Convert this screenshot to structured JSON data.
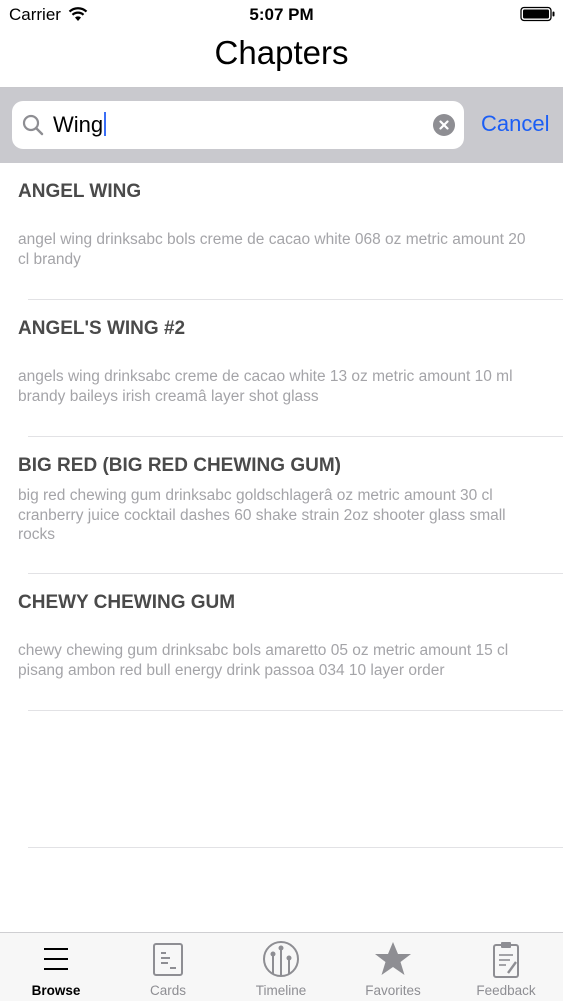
{
  "status_bar": {
    "carrier": "Carrier",
    "time": "5:07 PM"
  },
  "nav": {
    "title": "Chapters"
  },
  "search": {
    "query": "Wing",
    "cancel_label": "Cancel"
  },
  "results": [
    {
      "title": "ANGEL WING",
      "description": "angel wing drinksabc bols creme de cacao white 068 oz metric amount 20 cl brandy"
    },
    {
      "title": "ANGEL'S WING #2",
      "description": "angels wing drinksabc creme de cacao white 13 oz metric amount 10 ml brandy baileys irish creamâ layer shot glass"
    },
    {
      "title": "BIG RED  (BIG RED CHEWING GUM)",
      "description": "big red chewing gum drinksabc goldschlagerâ oz metric amount 30 cl cranberry juice cocktail dashes 60 shake strain 2oz shooter glass small rocks"
    },
    {
      "title": "CHEWY CHEWING GUM",
      "description": "chewy chewing gum drinksabc bols amaretto 05 oz metric amount 15 cl pisang ambon red bull energy drink passoa 034 10 layer order"
    }
  ],
  "tab_bar": {
    "tabs": [
      {
        "label": "Browse",
        "icon": "list-icon",
        "active": true
      },
      {
        "label": "Cards",
        "icon": "cards-icon",
        "active": false
      },
      {
        "label": "Timeline",
        "icon": "timeline-icon",
        "active": false
      },
      {
        "label": "Favorites",
        "icon": "star-icon",
        "active": false
      },
      {
        "label": "Feedback",
        "icon": "clipboard-icon",
        "active": false
      }
    ]
  },
  "colors": {
    "accent": "#1b5ef5",
    "search_bar_bg": "#c9c9ce",
    "title_text": "#4a4a4a",
    "desc_text": "#a4a4a8"
  }
}
